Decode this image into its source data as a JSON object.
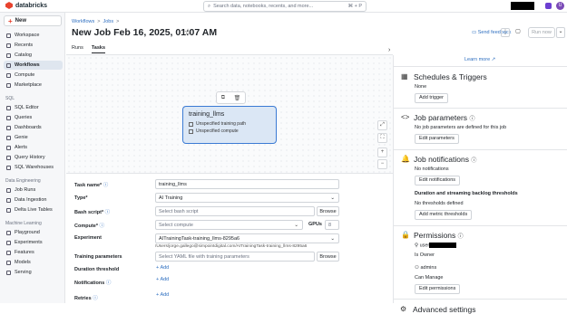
{
  "brand": {
    "name": "databricks",
    "accent": "#e8432e"
  },
  "search": {
    "placeholder": "Search data, notebooks, recents, and more...",
    "shortcut": "⌘ + P"
  },
  "user_initial": "U",
  "sidebar": {
    "new_label": "New",
    "items_top": [
      "Workspace",
      "Recents",
      "Catalog",
      "Workflows",
      "Compute",
      "Marketplace"
    ],
    "active": "Workflows",
    "sql_section": "SQL",
    "sql_items": [
      "SQL Editor",
      "Queries",
      "Dashboards",
      "Genie",
      "Alerts",
      "Query History",
      "SQL Warehouses"
    ],
    "de_section": "Data Engineering",
    "de_items": [
      "Job Runs",
      "Data Ingestion",
      "Delta Live Tables"
    ],
    "ml_section": "Machine Learning",
    "ml_items": [
      "Playground",
      "Experiments",
      "Features",
      "Models",
      "Serving"
    ]
  },
  "breadcrumb": {
    "a": "Workflows",
    "b": "Jobs"
  },
  "page_title": "New Job Feb 16, 2025, 01:07 AM",
  "header": {
    "send_feedback": "Send feedback",
    "run_now": "Run now"
  },
  "tabs": {
    "runs": "Runs",
    "tasks": "Tasks"
  },
  "node": {
    "title": "training_llms",
    "line1": "Unspecified training path",
    "line2": "Unspecified compute"
  },
  "form": {
    "task_name_label": "Task name*",
    "task_name_value": "training_llms",
    "type_label": "Type*",
    "type_value": "AI Training",
    "bash_label": "Bash script*",
    "bash_placeholder": "Select bash script",
    "browse": "Browse",
    "compute_label": "Compute*",
    "compute_placeholder": "Select compute",
    "gpus_label": "GPUs",
    "gpus_value": "8",
    "experiment_label": "Experiment",
    "experiment_value": "AITrainingTask-training_llms-8295a6",
    "experiment_path": "/Users/jorge.gallego@simpointdigital.com/AITrainingTask-training_llms-8295a6",
    "params_label": "Training parameters",
    "params_placeholder": "Select YAML file with training parameters",
    "duration_label": "Duration threshold",
    "notifications_label": "Notifications",
    "retries_label": "Retries",
    "add": "Add"
  },
  "right": {
    "learn_more": "Learn more",
    "schedules_title": "Schedules & Triggers",
    "schedules_none": "None",
    "add_trigger": "Add trigger",
    "params_title": "Job parameters",
    "params_none": "No job parameters are defined for this job",
    "edit_params": "Edit parameters",
    "notif_title": "Job notifications",
    "notif_none": "No notifications",
    "edit_notif": "Edit notifications",
    "duration_title": "Duration and streaming backlog thresholds",
    "duration_none": "No thresholds defined",
    "add_metric": "Add metric thresholds",
    "perms_title": "Permissions",
    "user_prefix": "user",
    "is_owner": "Is Owner",
    "admins": "admins",
    "can_manage": "Can Manage",
    "edit_perms": "Edit permissions",
    "advanced_title": "Advanced settings"
  }
}
